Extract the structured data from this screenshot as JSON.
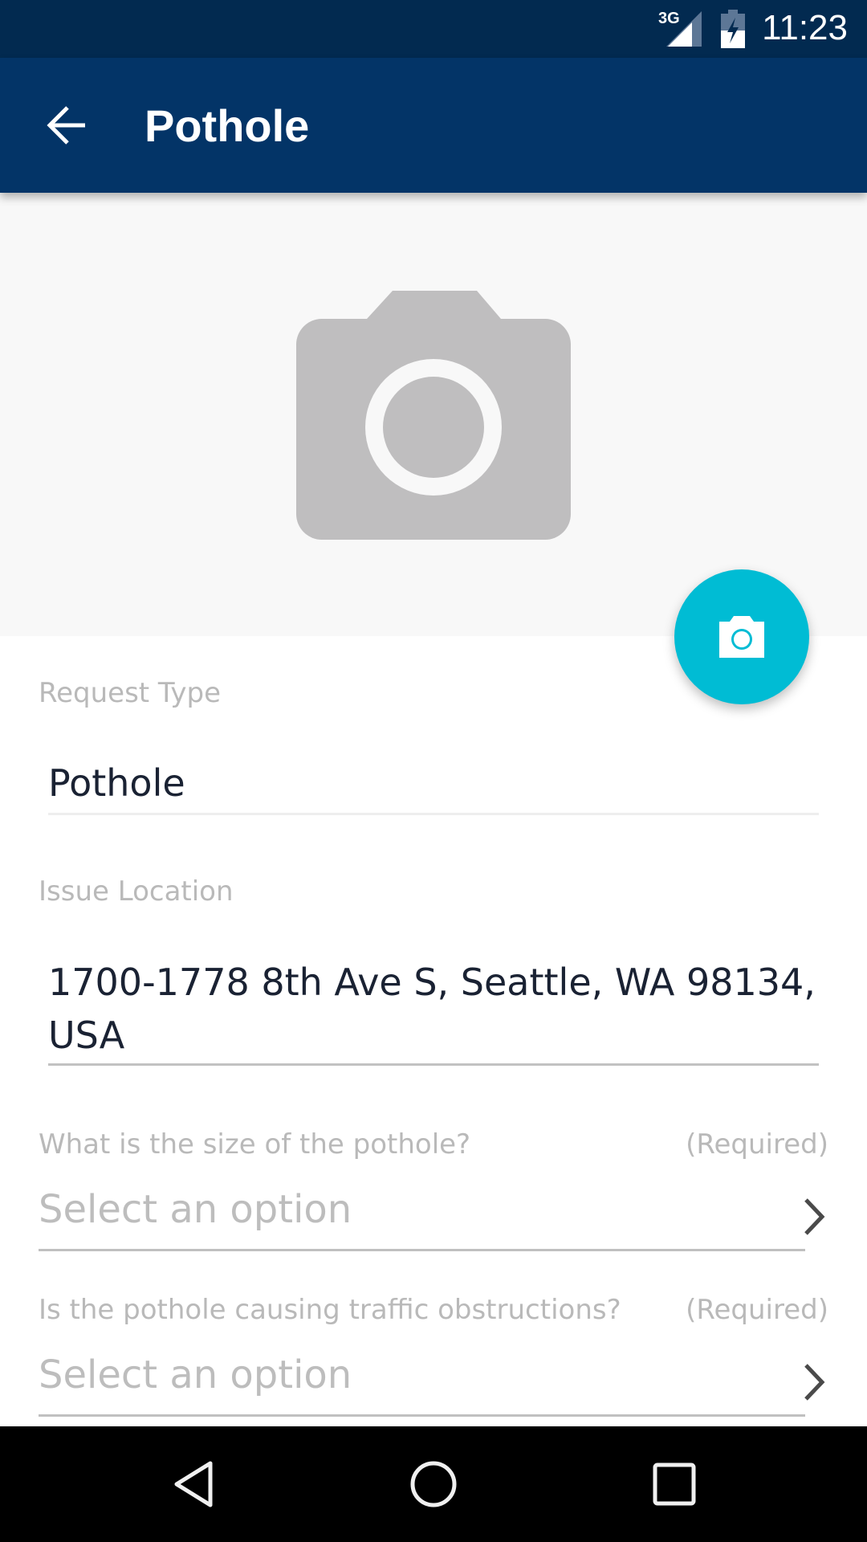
{
  "status_bar": {
    "network": "3G",
    "time": "11:23",
    "icons": [
      "signal-icon",
      "battery-charging-icon"
    ]
  },
  "app_bar": {
    "back_icon": "arrow-left-icon",
    "title": "Pothole"
  },
  "photo": {
    "placeholder_icon": "camera-icon",
    "add_photo_icon": "camera-icon"
  },
  "colors": {
    "status_bar": "#022a50",
    "app_bar": "#033467",
    "fab": "#00bcd4",
    "photo_bg": "#f8f8f8"
  },
  "form": {
    "request_type": {
      "label": "Request Type",
      "value": "Pothole"
    },
    "issue_location": {
      "label": "Issue Location",
      "value_line1": "1700-1778 8th Ave S, Seattle, WA 98134,",
      "value_line2": "USA"
    },
    "questions": [
      {
        "label": "What is the size of the pothole?",
        "required": "(Required)",
        "placeholder": "Select an option"
      },
      {
        "label": "Is the pothole causing traffic obstructions?",
        "required": "(Required)",
        "placeholder": "Select an option"
      }
    ]
  },
  "nav_bar": {
    "buttons": [
      "back-nav-icon",
      "home-nav-icon",
      "recents-nav-icon"
    ]
  }
}
